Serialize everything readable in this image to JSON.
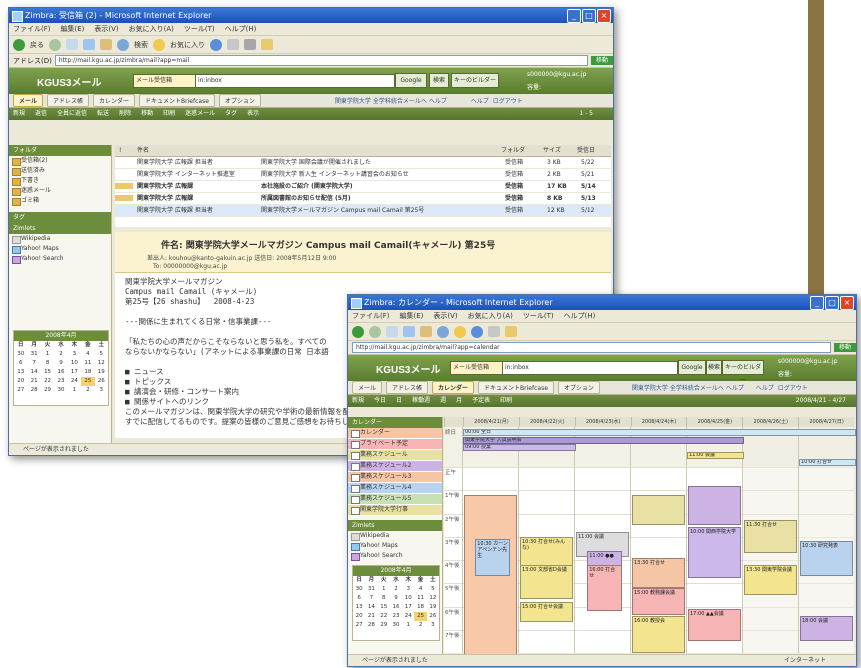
{
  "mail_window": {
    "title": "Zimbra: 受信箱 (2) - Microsoft Internet Explorer",
    "menu": [
      "ファイル(F)",
      "編集(E)",
      "表示(V)",
      "お気に入り(A)",
      "ツール(T)",
      "ヘルプ(H)"
    ],
    "toolbar": {
      "back": "戻る",
      "search": "検索",
      "favorites": "お気に入り"
    },
    "address_label": "アドレス(D)",
    "address": "http://mail.kgu.ac.jp/zimbra/mail?app=mail",
    "go_label": "移動",
    "logo": "KGUS3メール",
    "search_scope": "メール受信箱",
    "search_value": "in:inbox",
    "search_button": "Google",
    "search_button2": "検索",
    "search_button3": "キーのビルダー",
    "user": "s000000@kgu.ac.jp",
    "user_line": "容量:",
    "header_links": "関東学院大学 全学科統合メールヘ ヘルプ",
    "help_link": "ヘルプ",
    "logout_link": "ログアウト",
    "app_tabs": [
      "メール",
      "アドレス帳",
      "カレンダー",
      "ドキュメントBriefcase",
      "オプション"
    ],
    "actions": [
      "新規",
      "返信",
      "全員に返信",
      "転送",
      "削除",
      "移動",
      "印刷",
      "迷惑メール",
      "タグ",
      "表示"
    ],
    "pager": "1 - 5",
    "folders_header": "フォルダ",
    "folders": [
      "受信箱(2)",
      "送信済み",
      "下書き",
      "迷惑メール",
      "ゴミ箱"
    ],
    "tags_header": "タグ",
    "zimlets_header": "Zimlets",
    "zimlets": [
      "Wikipedia",
      "Yahoo! Maps",
      "Yahoo! Search"
    ],
    "mini_cal_title": "2008年4月",
    "mini_cal_days": [
      "日",
      "月",
      "火",
      "水",
      "木",
      "金",
      "土"
    ],
    "mini_cal_dates": [
      "30",
      "31",
      "1",
      "2",
      "3",
      "4",
      "5",
      "6",
      "7",
      "8",
      "9",
      "10",
      "11",
      "12",
      "13",
      "14",
      "15",
      "16",
      "17",
      "18",
      "19",
      "20",
      "21",
      "22",
      "23",
      "24",
      "25",
      "26",
      "27",
      "28",
      "29",
      "30",
      "1",
      "2",
      "3"
    ],
    "mini_cal_today": "25",
    "columns": [
      "!",
      "件名",
      "フォルダ",
      "サイズ",
      "受信日"
    ],
    "messages": [
      {
        "from": "関東学院大学 広報課 担当者",
        "subject": "関東学院大学 国際会議が開催されました",
        "folder": "受信箱",
        "size": "3 KB",
        "date": "5/22",
        "unread": false,
        "selected": false
      },
      {
        "from": "関東学院大学 インターネット推進室",
        "subject": "関東学院大学 新入生 インターネット講習会のお知らせ",
        "folder": "受信箱",
        "size": "2 KB",
        "date": "5/21",
        "unread": false,
        "selected": false
      },
      {
        "from": "関東学院大学 広報課",
        "subject": "本社施設のご紹介 (関東学院大学)",
        "folder": "受信箱",
        "size": "17 KB",
        "date": "5/14",
        "unread": true,
        "selected": false
      },
      {
        "from": "関東学院大学 広報課",
        "subject": "所属図書館のお知らせ配信 (5月)",
        "folder": "受信箱",
        "size": "8 KB",
        "date": "5/13",
        "unread": true,
        "selected": false
      },
      {
        "from": "関東学院大学 広報課 担当者",
        "subject": "関東学院大学メールマガジン Campus mail Camail 第25号",
        "folder": "受信箱",
        "size": "12 KB",
        "date": "5/12",
        "unread": false,
        "selected": true
      }
    ],
    "reading": {
      "subject": "件名: 関東学院大学メールマガジン Campus mail Camail(キャメール) 第25号",
      "from_line": "差出人: kouhou@kanto-gakuin.ac.jp  送信日: 2008年5月12日 9:00",
      "to_line": "To: 00000000@kgu.ac.jp",
      "body": "関東学院大学メールマガジン\nCampus mail Camail (キャメール)\n第25号【26 shashu】  2008-4-23\n\n---関係に生まれてくる日常・信事業課---\n\n「私たちの心の声だからこそならないと思う私を。すべての\nならないかならない」(アネットによる事業課の日常 日本語\n\n■ ニュース\n■ トピックス\n■ 講演会・研修・コンサート案内\n■ 関係サイトへのリンク\nこのメールマガジンは、関東学院大学の研究や学術の最新情報を配信しています。\nすでに配信してるものです。提案の皆様のご意見ご感想をお待ちしております。"
    },
    "status": "ページが表示されました"
  },
  "calendar_window": {
    "title": "Zimbra: カレンダー - Microsoft Internet Explorer",
    "menu": [
      "ファイル(F)",
      "編集(E)",
      "表示(V)",
      "お気に入り(A)",
      "ツール(T)",
      "ヘルプ(H)"
    ],
    "address": "http://mail.kgu.ac.jp/zimbra/mail?app=calendar",
    "go_label": "移動",
    "logo": "KGUS3メール",
    "search_scope": "メール受信箱",
    "search_value": "in:inbox",
    "search_button": "Google",
    "search_button2": "検索",
    "search_button3": "キーのビルダー",
    "user": "s000000@kgu.ac.jp",
    "user_line": "容量:",
    "header_links": "関東学院大学 全学科統合メールヘ ヘルプ",
    "help_link": "ヘルプ",
    "logout_link": "ログアウト",
    "app_tabs": [
      "メール",
      "アドレス帳",
      "カレンダー",
      "ドキュメントBriefcase",
      "オプション"
    ],
    "actions": [
      "新規",
      "今日",
      "日",
      "稼働週",
      "週",
      "月",
      "予定表",
      "印刷"
    ],
    "pager": "2008/4/21 - 4/27",
    "calendars_header": "カレンダー",
    "calendars": [
      {
        "name": "カレンダー",
        "color": "#f4c6a6"
      },
      {
        "name": "プライベート予定",
        "color": "#f7b4b4"
      },
      {
        "name": "業務スケジュール",
        "color": "#e9e1a4"
      },
      {
        "name": "業務スケジュール2",
        "color": "#cdb3e3"
      },
      {
        "name": "業務スケジュール3",
        "color": "#f4c6a6"
      },
      {
        "name": "業務スケジュール4",
        "color": "#b9d3ee"
      },
      {
        "name": "業務スケジュール5",
        "color": "#c7e0b4"
      },
      {
        "name": "関東学院大学行事",
        "color": "#e9e1a4"
      }
    ],
    "zimlets_header": "Zimlets",
    "zimlets": [
      "Wikipedia",
      "Yahoo! Maps",
      "Yahoo! Search"
    ],
    "mini_cal_title": "2008年4月",
    "mini_cal_days": [
      "日",
      "月",
      "火",
      "水",
      "木",
      "金",
      "土"
    ],
    "mini_cal_dates": [
      "30",
      "31",
      "1",
      "2",
      "3",
      "4",
      "5",
      "6",
      "7",
      "8",
      "9",
      "10",
      "11",
      "12",
      "13",
      "14",
      "15",
      "16",
      "17",
      "18",
      "19",
      "20",
      "21",
      "22",
      "23",
      "24",
      "25",
      "26",
      "27",
      "28",
      "29",
      "30",
      "1",
      "2",
      "3"
    ],
    "mini_cal_today": "25",
    "week_days": [
      "2008/4/21(月)",
      "2008/4/22(火)",
      "2008/4/23(水)",
      "2008/4/24(木)",
      "2008/4/25(金)",
      "2008/4/26(土)",
      "2008/4/27(日)"
    ],
    "hours": [
      "終日",
      "正午",
      "1午後",
      "2午後",
      "3午後",
      "4午後",
      "5午後",
      "6午後",
      "7午後"
    ],
    "allday_events": [
      {
        "day": 0,
        "span": 7,
        "text": "00:00 全日",
        "color": "#cfe6f5"
      },
      {
        "day": 0,
        "span": 5,
        "text": "関東学院大学 入試説明会",
        "color": "#a99ad6"
      },
      {
        "day": 0,
        "span": 2,
        "text": "09:00 授業",
        "color": "#ccb8ea"
      },
      {
        "day": 4,
        "span": 1,
        "text": "11:00 会議",
        "color": "#f3e48f"
      },
      {
        "day": 6,
        "span": 1,
        "text": "10:00 打合せ",
        "color": "#cfe6f5"
      }
    ],
    "events": [
      {
        "day": 0,
        "start": 1.2,
        "end": 8.0,
        "text": "",
        "color": "#f7c9a8"
      },
      {
        "day": 0,
        "start": 3.1,
        "end": 4.6,
        "text": "10:30 カーン アペンテン先生",
        "color": "#b9d3ee"
      },
      {
        "day": 1,
        "start": 3.0,
        "end": 4.2,
        "text": "10:30 打合せ(みんな)",
        "color": "#f3e48f"
      },
      {
        "day": 1,
        "start": 4.2,
        "end": 5.6,
        "text": "13:00 文部省D会議",
        "color": "#f3e48f"
      },
      {
        "day": 1,
        "start": 5.8,
        "end": 6.6,
        "text": "15:00 打合せ会議",
        "color": "#f3e48f"
      },
      {
        "day": 2,
        "start": 2.8,
        "end": 3.8,
        "text": "11:00 会議",
        "color": "#ddd"
      },
      {
        "day": 2,
        "start": 3.6,
        "end": 4.9,
        "text": "11:00 ●●",
        "color": "#cdb3e3"
      },
      {
        "day": 2,
        "start": 4.2,
        "end": 6.1,
        "text": "16:00 打合せ",
        "color": "#f7b4b4"
      },
      {
        "day": 3,
        "start": 1.2,
        "end": 2.4,
        "text": "",
        "color": "#e9e1a4"
      },
      {
        "day": 3,
        "start": 3.9,
        "end": 5.1,
        "text": "13:30 打合せ",
        "color": "#f4c6a6"
      },
      {
        "day": 3,
        "start": 5.2,
        "end": 6.3,
        "text": "15:00 教務課会議",
        "color": "#f7b4b4"
      },
      {
        "day": 3,
        "start": 6.4,
        "end": 7.9,
        "text": "16:00 教授会",
        "color": "#f3e48f"
      },
      {
        "day": 4,
        "start": 0.8,
        "end": 2.4,
        "text": "",
        "color": "#cdb3e3"
      },
      {
        "day": 4,
        "start": 2.6,
        "end": 4.7,
        "text": "10:00 関西学院大学",
        "color": "#ccb8ea"
      },
      {
        "day": 4,
        "start": 6.1,
        "end": 7.4,
        "text": "17:00 ▲▲会議",
        "color": "#f7b4b4"
      },
      {
        "day": 5,
        "start": 2.3,
        "end": 3.6,
        "text": "11:30 打合せ",
        "color": "#e9e1a4"
      },
      {
        "day": 5,
        "start": 4.2,
        "end": 5.4,
        "text": "13:30 関東学院会議",
        "color": "#f3e48f"
      },
      {
        "day": 6,
        "start": 3.2,
        "end": 4.6,
        "text": "10:30 研究発表",
        "color": "#b9d3ee"
      },
      {
        "day": 6,
        "start": 6.4,
        "end": 7.4,
        "text": "18:00 会議",
        "color": "#cdb3e3"
      }
    ],
    "status": "ページが表示されました",
    "status_right": "インターネット"
  },
  "colors": {
    "zimbra_green": "#6b8d3c",
    "titlebar_blue": "#2a62c9",
    "selected_row": "#dbe8f7"
  }
}
